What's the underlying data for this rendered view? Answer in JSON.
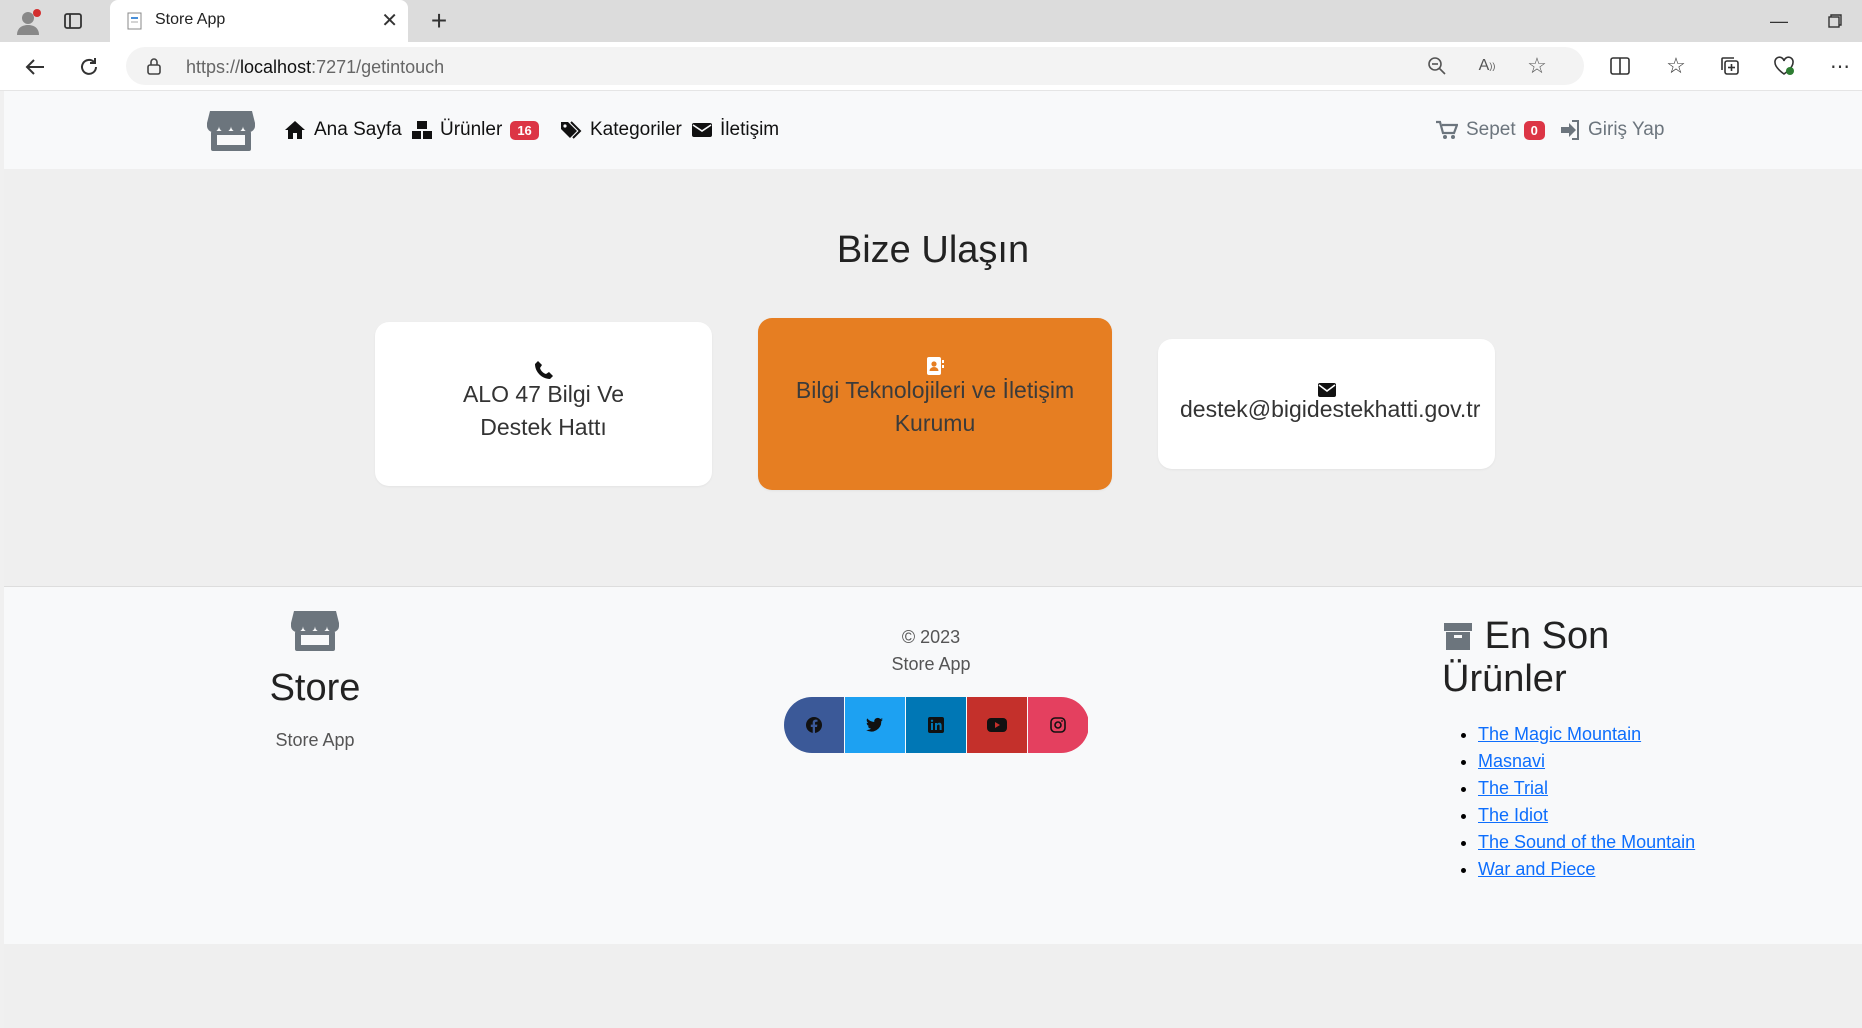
{
  "browser": {
    "tab_title": "Store App",
    "url_prefix": "https://",
    "url_host": "localhost",
    "url_rest": ":7271/getintouch"
  },
  "navbar": {
    "home": "Ana Sayfa",
    "products": "Ürünler",
    "products_count": "16",
    "categories": "Kategoriler",
    "contact": "İletişim",
    "cart": "Sepet",
    "cart_count": "0",
    "login": "Giriş Yap"
  },
  "main": {
    "heading": "Bize Ulaşın",
    "cards": [
      {
        "icon": "phone-icon",
        "text": "ALO 47 Bilgi Ve Destek Hattı"
      },
      {
        "icon": "address-book-icon",
        "text": "Bilgi Teknolojileri ve İletişim Kurumu"
      },
      {
        "icon": "envelope-icon",
        "text": "destek@bigidestekhatti.gov.tr"
      }
    ]
  },
  "footer": {
    "brand": "Store",
    "brand_sub": "Store App",
    "copyright": "© 2023",
    "copyright_sub": "Store App",
    "social": [
      "facebook",
      "twitter",
      "linkedin",
      "youtube",
      "instagram"
    ],
    "latest_title": "En Son Ürünler",
    "latest_items": [
      "The Magic Mountain",
      "Masnavi",
      "The Trial",
      "The Idiot",
      "The Sound of the Mountain",
      "War and Piece"
    ]
  },
  "colors": {
    "accent_orange": "#e67e22",
    "badge_red": "#dc3545",
    "link_blue": "#0d6efd",
    "facebook": "#3b5998",
    "twitter": "#1da1f2",
    "linkedin": "#0077b5",
    "youtube": "#c4302b",
    "instagram": "#e4405f"
  }
}
